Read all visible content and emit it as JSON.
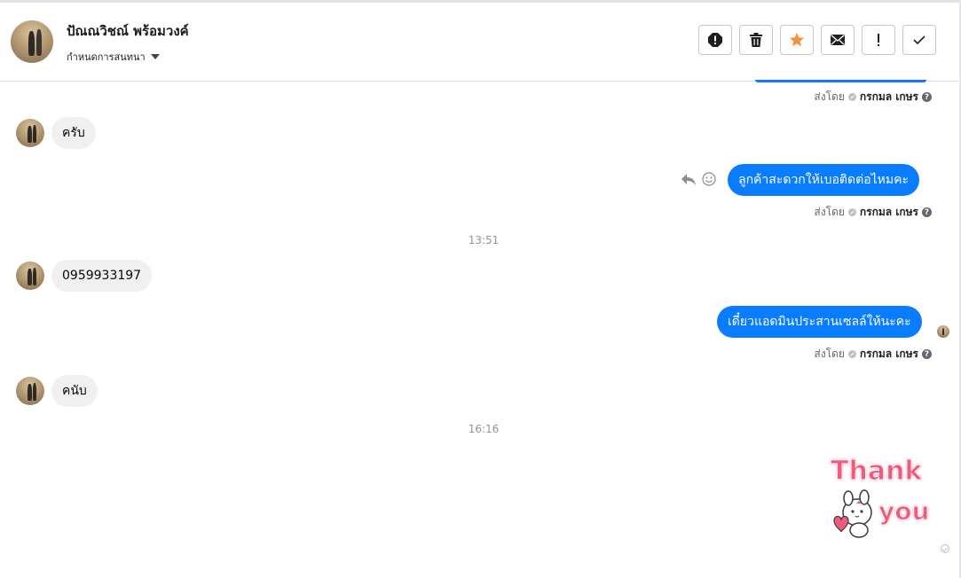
{
  "header": {
    "contact_name": "ปัณณวิชณ์ พร้อมวงค์",
    "assign_label": "กำหนดการสนทนา"
  },
  "actions": [
    {
      "name": "spam-icon",
      "label": "!"
    },
    {
      "name": "trash-icon"
    },
    {
      "name": "star-icon"
    },
    {
      "name": "envelope-icon"
    },
    {
      "name": "follow-up-icon",
      "label": "!"
    },
    {
      "name": "done-icon"
    }
  ],
  "sent_by": {
    "prefix": "ส่งโดย",
    "agent": "กรกมล เกษร",
    "help": "?"
  },
  "messages": {
    "m1": "ครับ",
    "m2": "ลูกค้าสะดวกให้เบอติดต่อไหมคะ",
    "m3": "0959933197",
    "m4": "เดี๋ยวแอดมินประสานเซลล์ให้นะคะ",
    "m5": "คนับ"
  },
  "timestamps": {
    "t1": "13:51",
    "t2": "16:16"
  },
  "sticker": {
    "line1": "Thank",
    "line2": "you"
  },
  "colors": {
    "outgoing_bubble": "#0a7cff",
    "incoming_bubble": "#f0f0f0",
    "star": "#f7923a"
  }
}
